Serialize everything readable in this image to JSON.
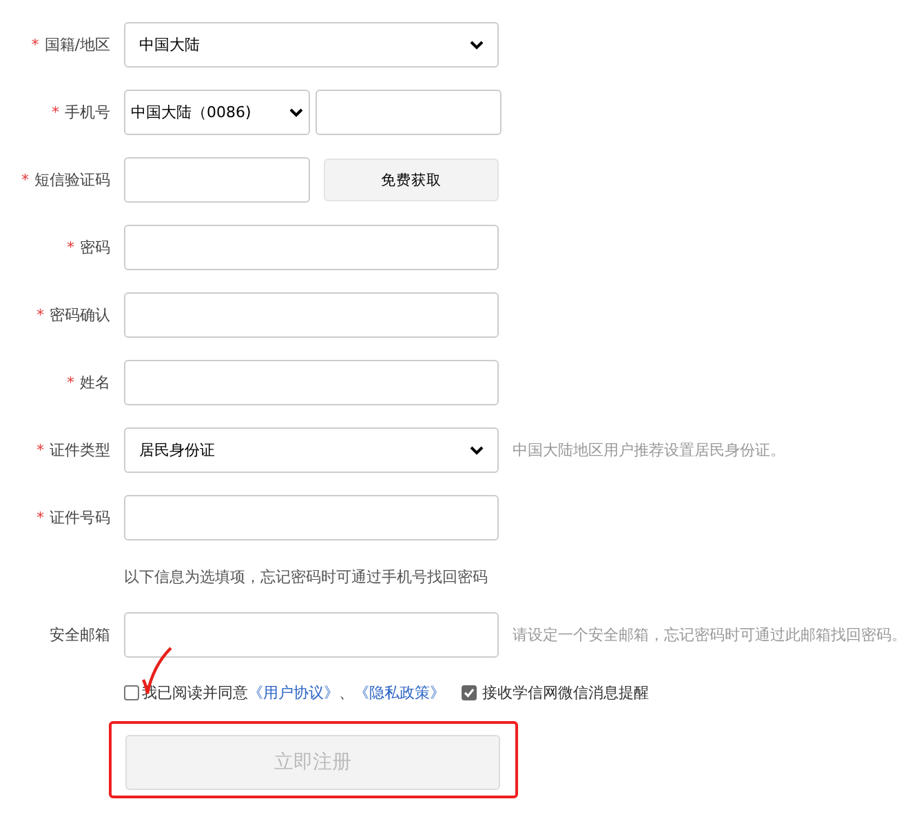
{
  "fields": [
    {
      "kind": "select",
      "marker": "*",
      "label": "国籍/地区",
      "value": "中国大陆"
    },
    {
      "kind": "phone",
      "marker": "*",
      "label": "手机号",
      "prefix": "中国大陆（0086)"
    },
    {
      "kind": "sms",
      "marker": "*",
      "label": "短信验证码",
      "button": "免费获取"
    },
    {
      "kind": "input",
      "marker": "*",
      "label": "密码"
    },
    {
      "kind": "input",
      "marker": "*",
      "label": "密码确认"
    },
    {
      "kind": "input",
      "marker": "*",
      "label": "姓名"
    },
    {
      "kind": "select",
      "marker": "*",
      "label": "证件类型",
      "value": "居民身份证",
      "hint": "中国大陆地区用户推荐设置居民身份证。"
    },
    {
      "kind": "input",
      "marker": "*",
      "label": "证件号码"
    },
    {
      "kind": "note",
      "text": "以下信息为选填项，忘记密码时可通过手机号找回密码"
    },
    {
      "kind": "input",
      "label": "安全邮箱",
      "hint": "请设定一个安全邮箱，忘记密码时可通过此邮箱找回密码。"
    }
  ],
  "agreement": {
    "checked": false,
    "text": "我已阅读并同意",
    "links": [
      "《用户协议》",
      "《隐私政策》"
    ],
    "separator": "、"
  },
  "wechat": {
    "checked": true,
    "label": "接收学信网微信消息提醒"
  },
  "submit": {
    "label": "立即注册",
    "disabled": true
  }
}
